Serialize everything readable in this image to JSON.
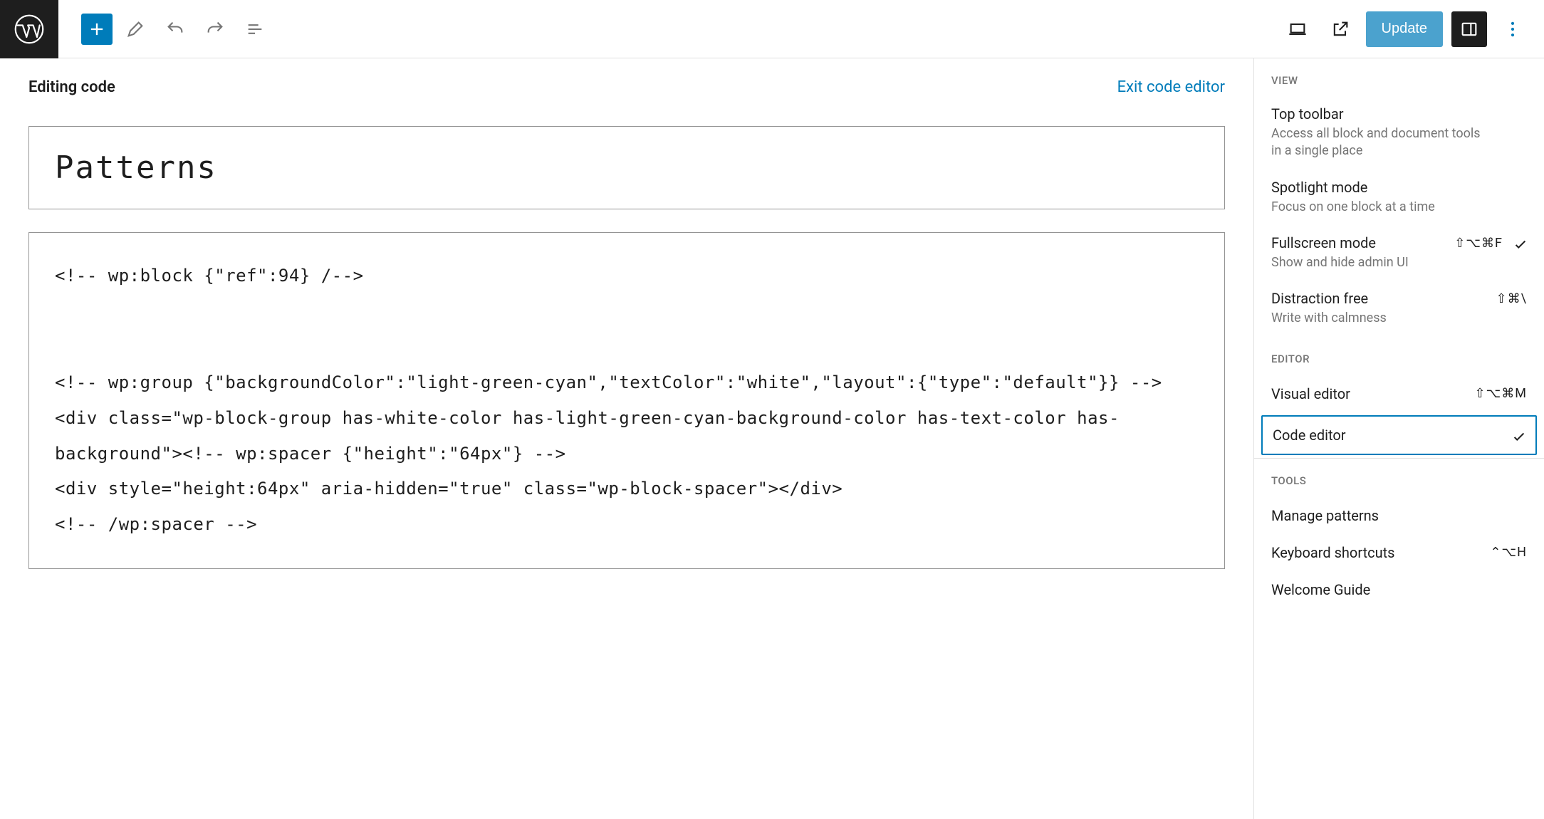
{
  "header": {
    "update_label": "Update"
  },
  "editor": {
    "editing_label": "Editing code",
    "exit_label": "Exit code editor",
    "title": "Patterns",
    "code": "<!-- wp:block {\"ref\":94} /-->\n\n\n<!-- wp:group {\"backgroundColor\":\"light-green-cyan\",\"textColor\":\"white\",\"layout\":{\"type\":\"default\"}} -->\n<div class=\"wp-block-group has-white-color has-light-green-cyan-background-color has-text-color has-background\"><!-- wp:spacer {\"height\":\"64px\"} -->\n<div style=\"height:64px\" aria-hidden=\"true\" class=\"wp-block-spacer\"></div>\n<!-- /wp:spacer -->"
  },
  "options": {
    "view_label": "VIEW",
    "editor_label": "EDITOR",
    "tools_label": "TOOLS",
    "view_items": [
      {
        "title": "Top toolbar",
        "desc": "Access all block and document tools in a single place",
        "shortcut": "",
        "checked": false
      },
      {
        "title": "Spotlight mode",
        "desc": "Focus on one block at a time",
        "shortcut": "",
        "checked": false
      },
      {
        "title": "Fullscreen mode",
        "desc": "Show and hide admin UI",
        "shortcut": "⇧⌥⌘F",
        "checked": true
      },
      {
        "title": "Distraction free",
        "desc": "Write with calmness",
        "shortcut": "⇧⌘\\",
        "checked": false
      }
    ],
    "editor_items": [
      {
        "label": "Visual editor",
        "shortcut": "⇧⌥⌘M",
        "checked": false,
        "boxed": false
      },
      {
        "label": "Code editor",
        "shortcut": "",
        "checked": true,
        "boxed": true
      }
    ],
    "tools_items": [
      {
        "label": "Manage patterns",
        "shortcut": ""
      },
      {
        "label": "Keyboard shortcuts",
        "shortcut": "⌃⌥H"
      },
      {
        "label": "Welcome Guide",
        "shortcut": ""
      }
    ]
  }
}
